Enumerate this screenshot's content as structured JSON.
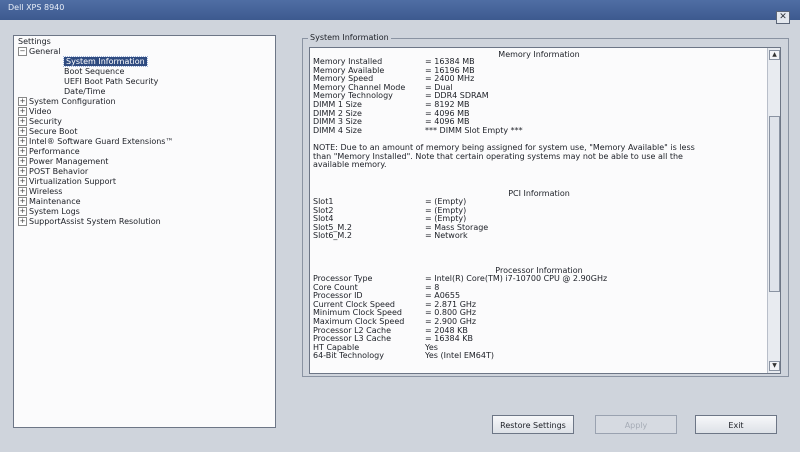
{
  "window": {
    "title": "Dell XPS 8940",
    "close_glyph": "✕"
  },
  "tree": {
    "root_label": "Settings",
    "items": [
      {
        "label": "General",
        "expanded": true,
        "children": [
          {
            "label": "System Information",
            "selected": true
          },
          {
            "label": "Boot Sequence"
          },
          {
            "label": "UEFI Boot Path Security"
          },
          {
            "label": "Date/Time"
          }
        ]
      },
      {
        "label": "System Configuration"
      },
      {
        "label": "Video"
      },
      {
        "label": "Security"
      },
      {
        "label": "Secure Boot"
      },
      {
        "label": "Intel® Software Guard Extensions™"
      },
      {
        "label": "Performance"
      },
      {
        "label": "Power Management"
      },
      {
        "label": "POST Behavior"
      },
      {
        "label": "Virtualization Support"
      },
      {
        "label": "Wireless"
      },
      {
        "label": "Maintenance"
      },
      {
        "label": "System Logs"
      },
      {
        "label": "SupportAssist System Resolution"
      }
    ]
  },
  "panel": {
    "legend": "System Information",
    "memory": {
      "title": "Memory Information",
      "rows": [
        {
          "k": "Memory Installed",
          "v": "= 16384 MB"
        },
        {
          "k": "Memory Available",
          "v": "= 16196 MB"
        },
        {
          "k": "Memory Speed",
          "v": "= 2400 MHz"
        },
        {
          "k": "Memory Channel Mode",
          "v": "= Dual"
        },
        {
          "k": "Memory Technology",
          "v": "= DDR4 SDRAM"
        },
        {
          "k": "DIMM 1 Size",
          "v": "= 8192 MB"
        },
        {
          "k": "DIMM 2 Size",
          "v": "= 4096 MB"
        },
        {
          "k": "DIMM 3 Size",
          "v": "= 4096 MB"
        },
        {
          "k": "DIMM 4 Size",
          "v": "*** DIMM Slot Empty ***"
        }
      ],
      "note": "NOTE: Due to an amount of memory being assigned for system use, \"Memory Available\" is less than \"Memory Installed\". Note that certain operating systems may not be able to use all the available memory."
    },
    "pci": {
      "title": "PCI Information",
      "rows": [
        {
          "k": "Slot1",
          "v": "= (Empty)"
        },
        {
          "k": "Slot2",
          "v": "= (Empty)"
        },
        {
          "k": "Slot4",
          "v": "= (Empty)"
        },
        {
          "k": "Slot5_M.2",
          "v": "= Mass Storage"
        },
        {
          "k": "Slot6_M.2",
          "v": "= Network"
        }
      ]
    },
    "processor": {
      "title": "Processor Information",
      "rows": [
        {
          "k": "Processor Type",
          "v": "= Intel(R) Core(TM) i7-10700 CPU @ 2.90GHz"
        },
        {
          "k": "Core Count",
          "v": "= 8"
        },
        {
          "k": "Processor ID",
          "v": "= A0655"
        },
        {
          "k": "Current Clock Speed",
          "v": "= 2.871 GHz"
        },
        {
          "k": "Minimum Clock Speed",
          "v": "= 0.800 GHz"
        },
        {
          "k": "Maximum Clock Speed",
          "v": "= 2.900 GHz"
        },
        {
          "k": "Processor L2 Cache",
          "v": "= 2048 KB"
        },
        {
          "k": "Processor L3 Cache",
          "v": "= 16384 KB"
        },
        {
          "k": "HT Capable",
          "v": "Yes"
        },
        {
          "k": "64-Bit Technology",
          "v": "Yes (Intel EM64T)"
        }
      ]
    },
    "scroll_up_glyph": "▲",
    "scroll_down_glyph": "▼"
  },
  "buttons": {
    "restore": "Restore Settings",
    "apply": "Apply",
    "exit": "Exit"
  }
}
